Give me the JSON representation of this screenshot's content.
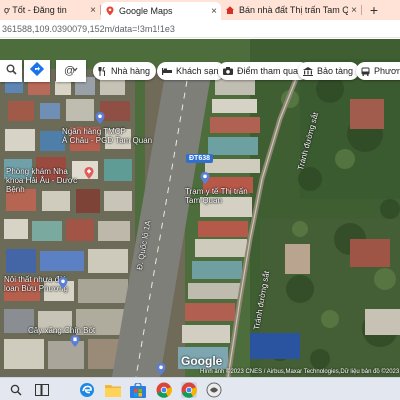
{
  "browser": {
    "tabs": [
      {
        "title": "ợ Tốt - Đăng tin",
        "close": "×"
      },
      {
        "title": "Google Maps",
        "close": "×"
      },
      {
        "title": "Bán nhà đất Thị trấn Tam Quan, ",
        "close": "×"
      }
    ],
    "new_tab": "+",
    "address": "361588,109.0390079,152m/data=!3m1!1e3"
  },
  "maps": {
    "chips": [
      {
        "label": "Nhà hàng",
        "icon": "fork-knife-icon"
      },
      {
        "label": "Khách sạn",
        "icon": "bed-icon"
      },
      {
        "label": "Điểm tham quan",
        "icon": "camera-icon"
      },
      {
        "label": "Bảo tàng",
        "icon": "museum-icon"
      },
      {
        "label": "Phương",
        "icon": "bus-icon"
      }
    ],
    "labels": {
      "bank": "Ngân hàng TMCP",
      "bank2": "Á Châu - PGD Tam Quan",
      "phongkham": "Phòng khám Nha",
      "phongkham2": "khoa Hải Âu - Dược",
      "phongkham3": "Bệnh",
      "road_dt": "ĐT638",
      "quocloa": "Đ. Quốc lộ 1A",
      "tranh1": "Tránh đường sắt",
      "tranh2": "Tránh đường sắt",
      "noithat": "Nội thất nhựa đài",
      "noithat2": "loan Bửu Phương",
      "cayxang": "Cây xăng Chín Bốt",
      "tuanloi": "Trạm y tế Thị trấn",
      "tuanloi2": "Tam Quan",
      "google": "Google",
      "attribution": "Hình ảnh ©2023 CNES / Airbus,Maxar Technologies,Dữ liệu bản đồ ©2023"
    }
  },
  "colors": {
    "tab_strip": "#ffe3d6",
    "road_badge": "#2f6fd0",
    "taskbar": "#e3e7ef"
  }
}
